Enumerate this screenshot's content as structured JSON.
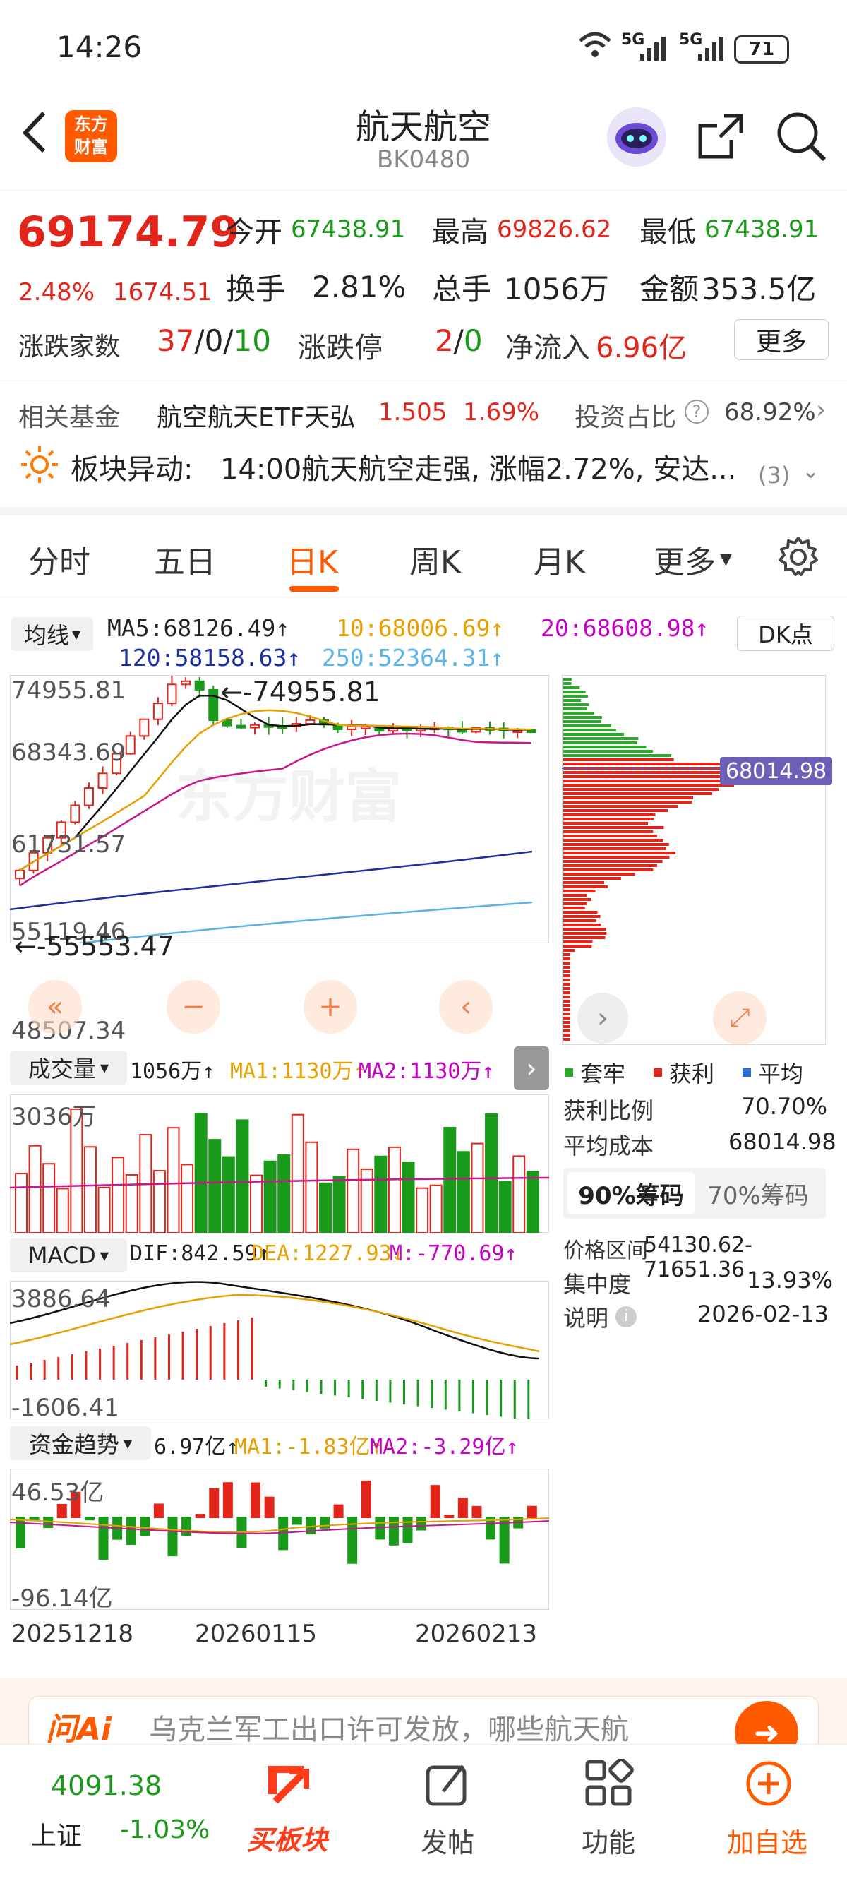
{
  "status": {
    "time": "14:26",
    "net1": "5G",
    "net2": "5G",
    "battery": "71"
  },
  "header": {
    "title": "航天航空",
    "code": "BK0480",
    "logo_line1": "东方",
    "logo_line2": "财富"
  },
  "quote": {
    "price": "69174.79",
    "pct": "2.48%",
    "chg": "1674.51",
    "open_label": "今开",
    "open": "67438.91",
    "high_label": "最高",
    "high": "69826.62",
    "low_label": "最低",
    "low": "67438.91",
    "turnover_label": "换手",
    "turnover": "2.81%",
    "volume_label": "总手",
    "volume": "1056万",
    "amount_label": "金额",
    "amount": "353.5亿",
    "breadth_label": "涨跌家数",
    "breadth_up": "37",
    "breadth_flat": "0",
    "breadth_down": "10",
    "limit_label": "涨跌停",
    "limit_up": "2",
    "limit_down": "0",
    "inflow_label": "净流入",
    "inflow": "6.96亿",
    "more_label": "更多"
  },
  "fund": {
    "label": "相关基金",
    "name": "航空航天ETF天弘",
    "price": "1.505",
    "pct": "1.69%",
    "ratio_label": "投资占比",
    "ratio": "68.92%",
    "alert_title": "板块异动:",
    "alert_text": "14:00航天航空走强, 涨幅2.72%, 安达...",
    "alert_count": "(3)"
  },
  "tabs": [
    "分时",
    "五日",
    "日K",
    "周K",
    "月K",
    "更多"
  ],
  "active_tab": "日K",
  "ma": {
    "btn": "均线",
    "ma5": "MA5:68126.49↑",
    "ma10": "10:68006.69↑",
    "ma20": "20:68608.98↑",
    "ma120": "120:58158.63↑",
    "ma250": "250:52364.31↑",
    "dk": "DK点"
  },
  "kline": {
    "y_top": "74955.81",
    "y_2": "68343.69",
    "y_3": "61731.57",
    "y_4": "55119.46",
    "y_bottom": "48507.34",
    "high_mark": "←-74955.81",
    "low_mark": "←-55553.47"
  },
  "volume": {
    "btn": "成交量",
    "val": "1056万↑",
    "ma1": "MA1:1130万↑",
    "ma2": "MA2:1130万↑",
    "y_top": "3036万"
  },
  "macd": {
    "btn": "MACD",
    "dif": "DIF:842.59↑",
    "dea": "DEA:1227.93↓",
    "m": "M:-770.69↑",
    "y_top": "3886.64",
    "y_bottom": "-1606.41"
  },
  "fundflow": {
    "btn": "资金趋势",
    "val": "6.97亿↑",
    "ma1": "MA1:-1.83亿↑",
    "ma2": "MA2:-3.29亿↑",
    "y_top": "46.53亿",
    "y_bottom": "-96.14亿"
  },
  "dates": [
    "20251218",
    "20260115",
    "20260213"
  ],
  "chips": {
    "price_tag": "68014.98",
    "legend": [
      "套牢",
      "获利",
      "平均"
    ],
    "profit_label": "获利比例",
    "profit": "70.70%",
    "avg_label": "平均成本",
    "avg": "68014.98",
    "tab90": "90%筹码",
    "tab70": "70%筹码",
    "range_label": "价格区间",
    "range": "54130.62-71651.36",
    "conc_label": "集中度",
    "conc": "13.93%",
    "note_label": "说明",
    "note": "2026-02-13"
  },
  "ai": {
    "brand": "问Ai",
    "text": "乌克兰军工出口许可发放，哪些航天航"
  },
  "bottom": {
    "index_val": "4091.38",
    "index_name": "上证",
    "index_pct": "-1.03%",
    "buy": "买板块",
    "post": "发帖",
    "func": "功能",
    "fav": "加自选"
  },
  "colors": {
    "up": "#e1251b",
    "down": "#1a9a1a",
    "accent": "#ff5a00"
  }
}
